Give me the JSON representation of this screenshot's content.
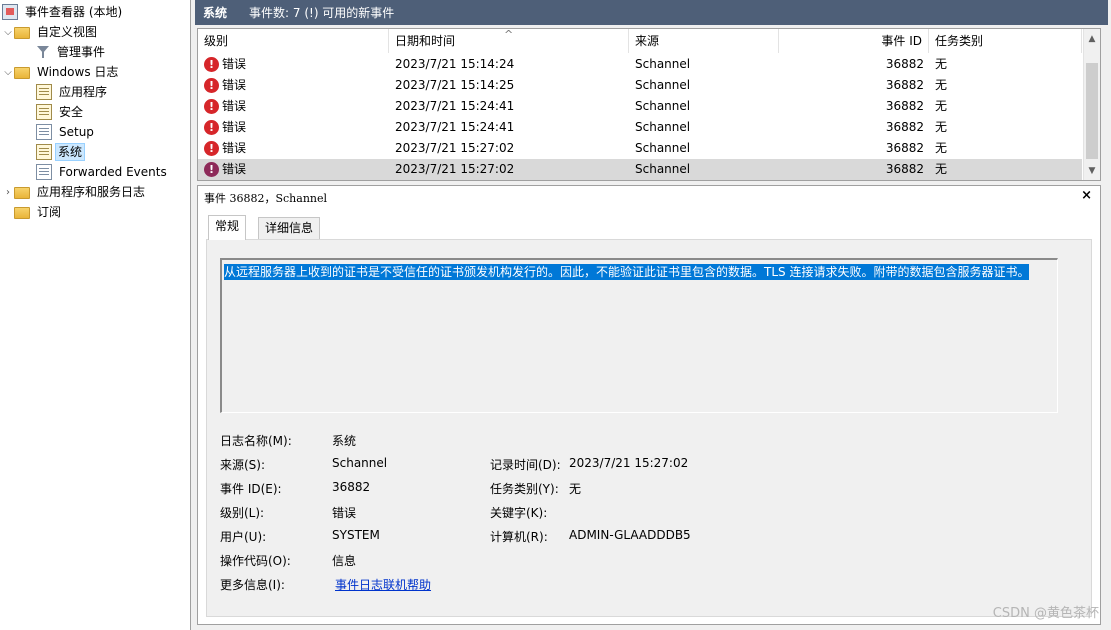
{
  "tree": {
    "items": [
      {
        "label": "事件查看器 (本地)",
        "icon": "event-viewer-icon",
        "indent": 0,
        "expander": ""
      },
      {
        "label": "自定义视图",
        "icon": "folder-icon",
        "indent": 1,
        "expander": "⌵"
      },
      {
        "label": "管理事件",
        "icon": "filter-icon",
        "indent": 2,
        "expander": ""
      },
      {
        "label": "Windows 日志",
        "icon": "folder-icon",
        "indent": 1,
        "expander": "⌵"
      },
      {
        "label": "应用程序",
        "icon": "log-icon",
        "indent": 2,
        "expander": ""
      },
      {
        "label": "安全",
        "icon": "log-icon",
        "indent": 2,
        "expander": ""
      },
      {
        "label": "Setup",
        "icon": "log-icon",
        "indent": 2,
        "expander": ""
      },
      {
        "label": "系统",
        "icon": "log-icon",
        "indent": 2,
        "expander": "",
        "selected": true
      },
      {
        "label": "Forwarded Events",
        "icon": "log-icon",
        "indent": 2,
        "expander": ""
      },
      {
        "label": "应用程序和服务日志",
        "icon": "folder-icon",
        "indent": 1,
        "expander": "›"
      },
      {
        "label": "订阅",
        "icon": "subscription-icon",
        "indent": 1,
        "expander": ""
      }
    ]
  },
  "header": {
    "title": "系统",
    "summary": "事件数: 7 (!) 可用的新事件"
  },
  "list": {
    "columns": [
      "级别",
      "日期和时间",
      "来源",
      "事件 ID",
      "任务类别"
    ],
    "sort_indicator": "^",
    "rows": [
      {
        "level": "错误",
        "datetime": "2023/7/21 15:14:24",
        "source": "Schannel",
        "event_id": "36882",
        "task": "无"
      },
      {
        "level": "错误",
        "datetime": "2023/7/21 15:14:25",
        "source": "Schannel",
        "event_id": "36882",
        "task": "无"
      },
      {
        "level": "错误",
        "datetime": "2023/7/21 15:24:41",
        "source": "Schannel",
        "event_id": "36882",
        "task": "无"
      },
      {
        "level": "错误",
        "datetime": "2023/7/21 15:24:41",
        "source": "Schannel",
        "event_id": "36882",
        "task": "无"
      },
      {
        "level": "错误",
        "datetime": "2023/7/21 15:27:02",
        "source": "Schannel",
        "event_id": "36882",
        "task": "无"
      },
      {
        "level": "错误",
        "datetime": "2023/7/21 15:27:02",
        "source": "Schannel",
        "event_id": "36882",
        "task": "无",
        "selected": true
      }
    ]
  },
  "detail": {
    "title": "事件 36882，Schannel",
    "close": "×",
    "tabs": [
      "常规",
      "详细信息"
    ],
    "description": "从远程服务器上收到的证书是不受信任的证书颁发机构发行的。因此，不能验证此证书里包含的数据。TLS 连接请求失败。附带的数据包含服务器证书。",
    "fields": {
      "log_name_label": "日志名称(M):",
      "log_name": "系统",
      "source_label": "来源(S):",
      "source": "Schannel",
      "logged_label": "记录时间(D):",
      "logged": "2023/7/21 15:27:02",
      "event_id_label": "事件 ID(E):",
      "event_id": "36882",
      "task_label": "任务类别(Y):",
      "task": "无",
      "level_label": "级别(L):",
      "level": "错误",
      "keywords_label": "关键字(K):",
      "keywords": "",
      "user_label": "用户(U):",
      "user": "SYSTEM",
      "computer_label": "计算机(R):",
      "computer": "ADMIN-GLAADDDB5",
      "opcode_label": "操作代码(O):",
      "opcode": "信息",
      "more_info_label": "更多信息(I):",
      "more_info_link": "事件日志联机帮助"
    }
  },
  "watermark": "CSDN @黄色茶杯"
}
